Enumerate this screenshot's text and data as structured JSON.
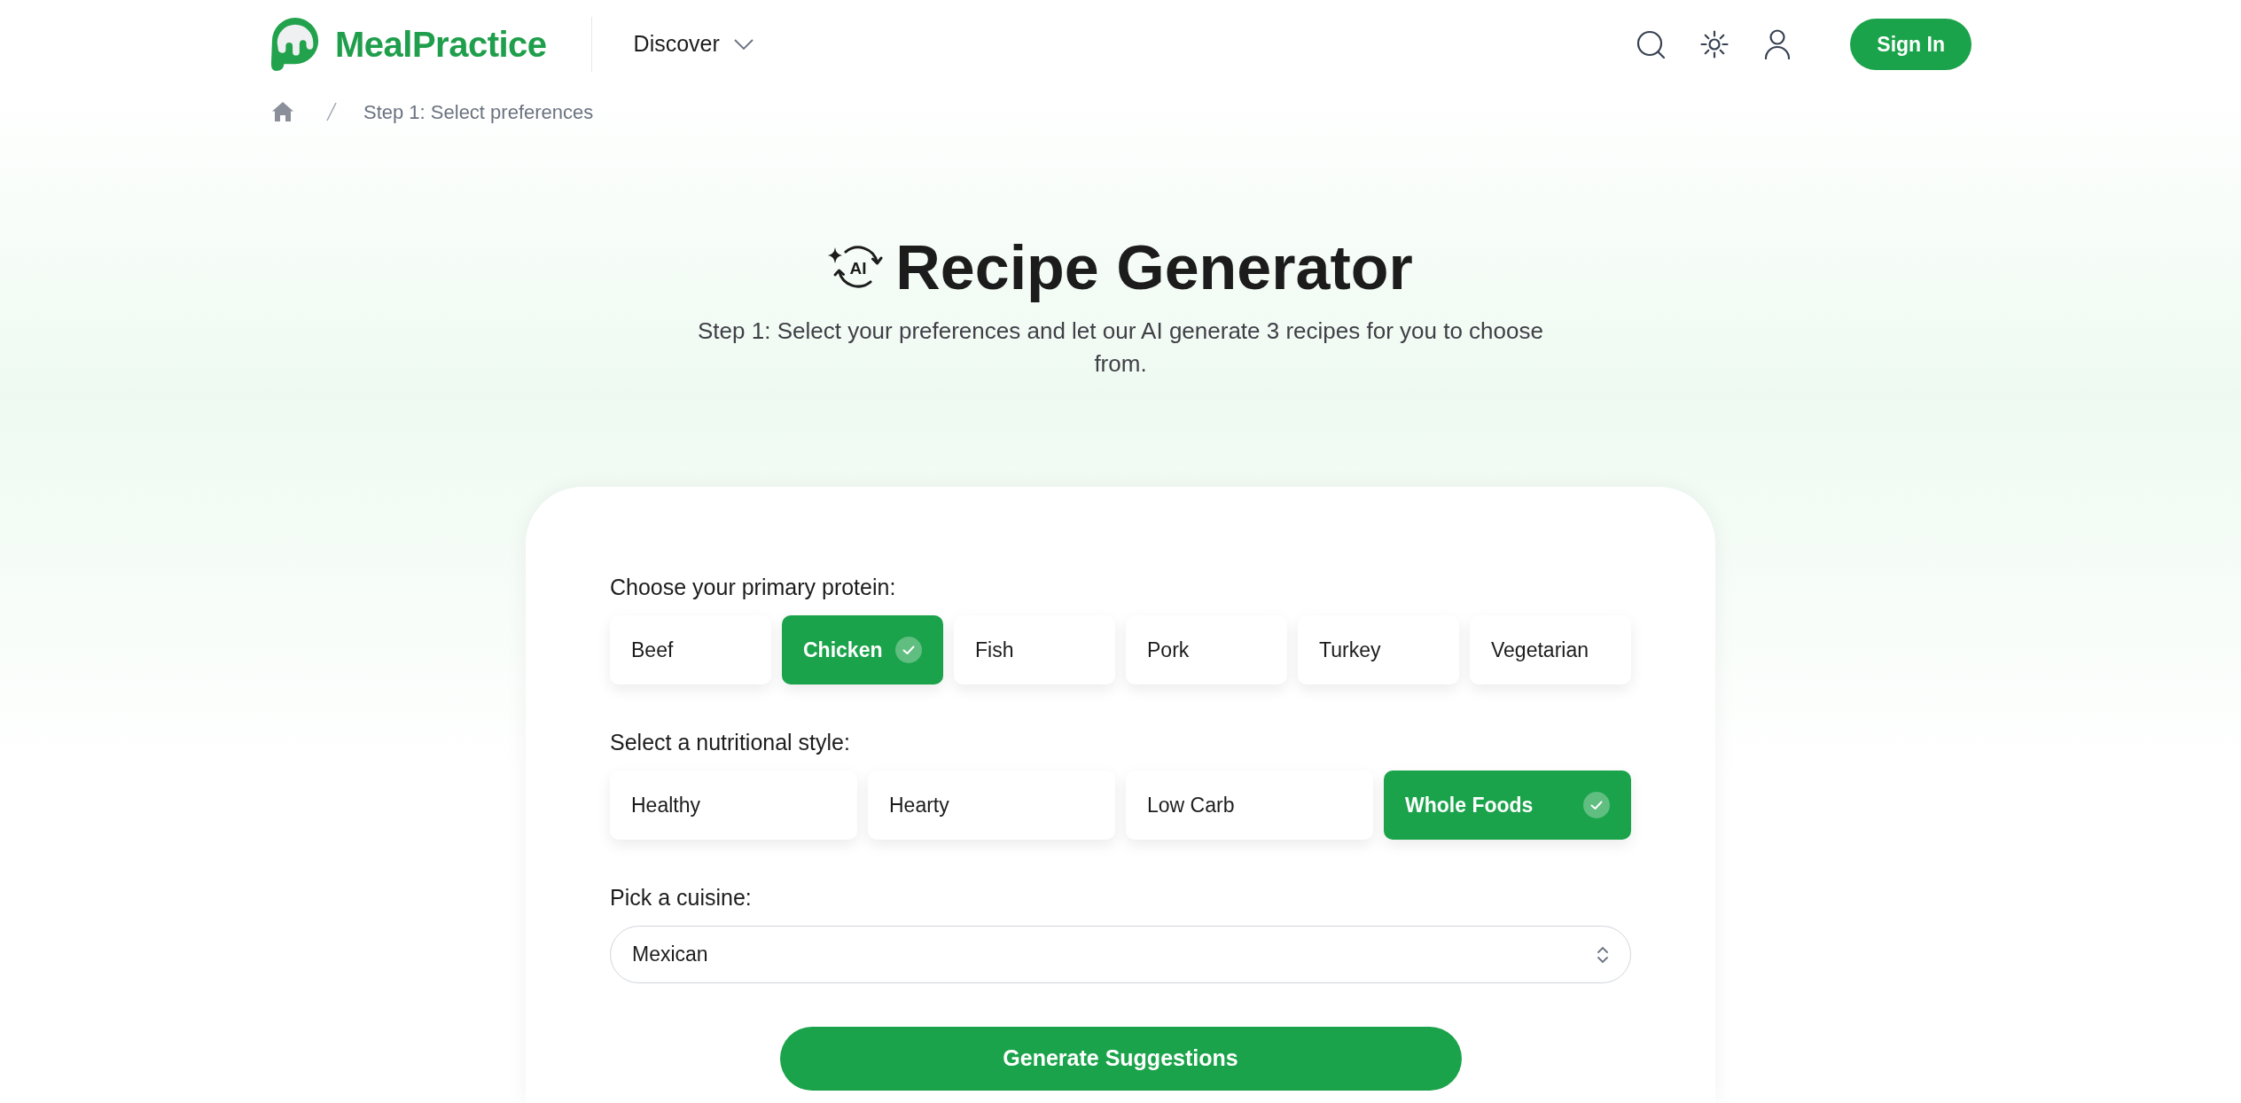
{
  "header": {
    "logo": "MealPractice",
    "nav": [
      {
        "label": "Discover"
      }
    ],
    "sign_in": "Sign In"
  },
  "breadcrumb": {
    "items": [
      {
        "label": "Step 1: Select preferences"
      }
    ]
  },
  "hero": {
    "icon_label": "AI",
    "title": "Recipe Generator",
    "subtitle": "Step 1: Select your preferences and let our AI generate 3 recipes for you to choose from."
  },
  "form": {
    "sections": [
      {
        "kind": "choice",
        "label": "Choose your primary protein:",
        "options": [
          {
            "label": "Beef",
            "selected": false
          },
          {
            "label": "Chicken",
            "selected": true
          },
          {
            "label": "Fish",
            "selected": false
          },
          {
            "label": "Pork",
            "selected": false
          },
          {
            "label": "Turkey",
            "selected": false
          },
          {
            "label": "Vegetarian",
            "selected": false
          }
        ]
      },
      {
        "kind": "choice",
        "label": "Select a nutritional style:",
        "options": [
          {
            "label": "Healthy",
            "selected": false
          },
          {
            "label": "Hearty",
            "selected": false
          },
          {
            "label": "Low Carb",
            "selected": false
          },
          {
            "label": "Whole Foods",
            "selected": true
          }
        ]
      },
      {
        "kind": "select",
        "label": "Pick a cuisine:",
        "value": "Mexican"
      }
    ],
    "submit": "Generate Suggestions"
  }
}
